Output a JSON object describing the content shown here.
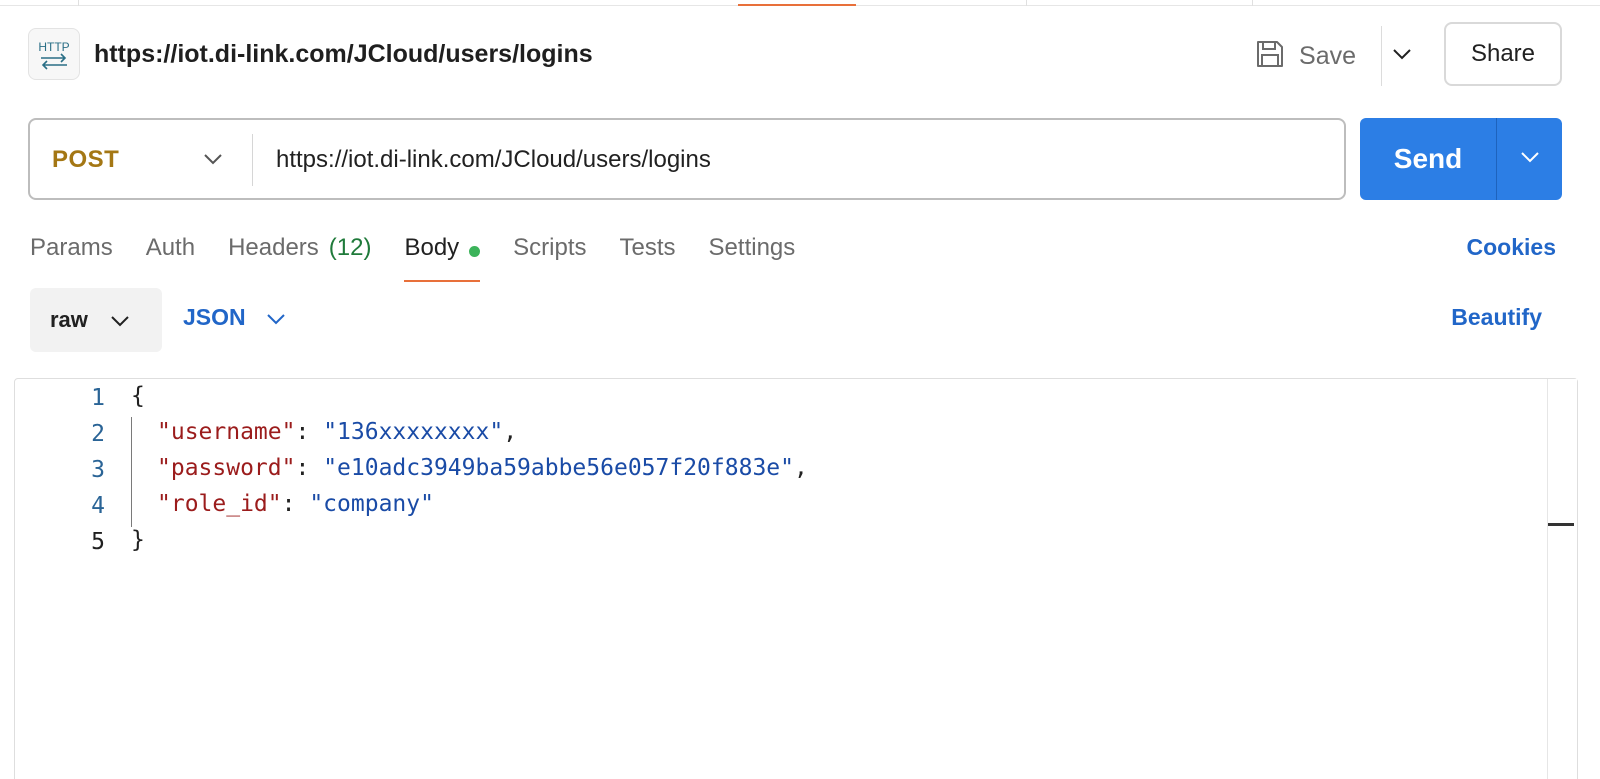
{
  "request": {
    "title": "https://iot.di-link.com/JCloud/users/logins",
    "method": "POST",
    "url": "https://iot.di-link.com/JCloud/users/logins"
  },
  "header": {
    "save_label": "Save",
    "share_label": "Share"
  },
  "send": {
    "label": "Send"
  },
  "tabs": [
    {
      "label": "Params"
    },
    {
      "label": "Auth"
    },
    {
      "label": "Headers",
      "count": "(12)"
    },
    {
      "label": "Body"
    },
    {
      "label": "Scripts"
    },
    {
      "label": "Tests"
    },
    {
      "label": "Settings"
    }
  ],
  "cookies_label": "Cookies",
  "body_options": {
    "mode": "raw",
    "format": "JSON",
    "beautify_label": "Beautify"
  },
  "editor": {
    "lines": [
      {
        "num": "1",
        "open": "{"
      },
      {
        "num": "2",
        "key": "\"username\"",
        "sep": ": ",
        "value": "\"136xxxxxxxx\"",
        "end": ","
      },
      {
        "num": "3",
        "key": "\"password\"",
        "sep": ": ",
        "value": "\"e10adc3949ba59abbe56e057f20f883e\"",
        "end": ","
      },
      {
        "num": "4",
        "key": "\"role_id\"",
        "sep": ": ",
        "value": "\"company\"",
        "end": ""
      },
      {
        "num": "5",
        "close": "}"
      }
    ]
  },
  "colors": {
    "accent": "#2c7ee5",
    "method_post": "#a47714",
    "tab_active_underline": "#e8703a",
    "link_blue": "#2166c8",
    "json_key": "#9b1c1c",
    "json_string": "#1a4ba6"
  },
  "icons": {
    "http": "http-request-icon",
    "save": "floppy-disk-icon",
    "chevron": "chevron-down-icon"
  }
}
